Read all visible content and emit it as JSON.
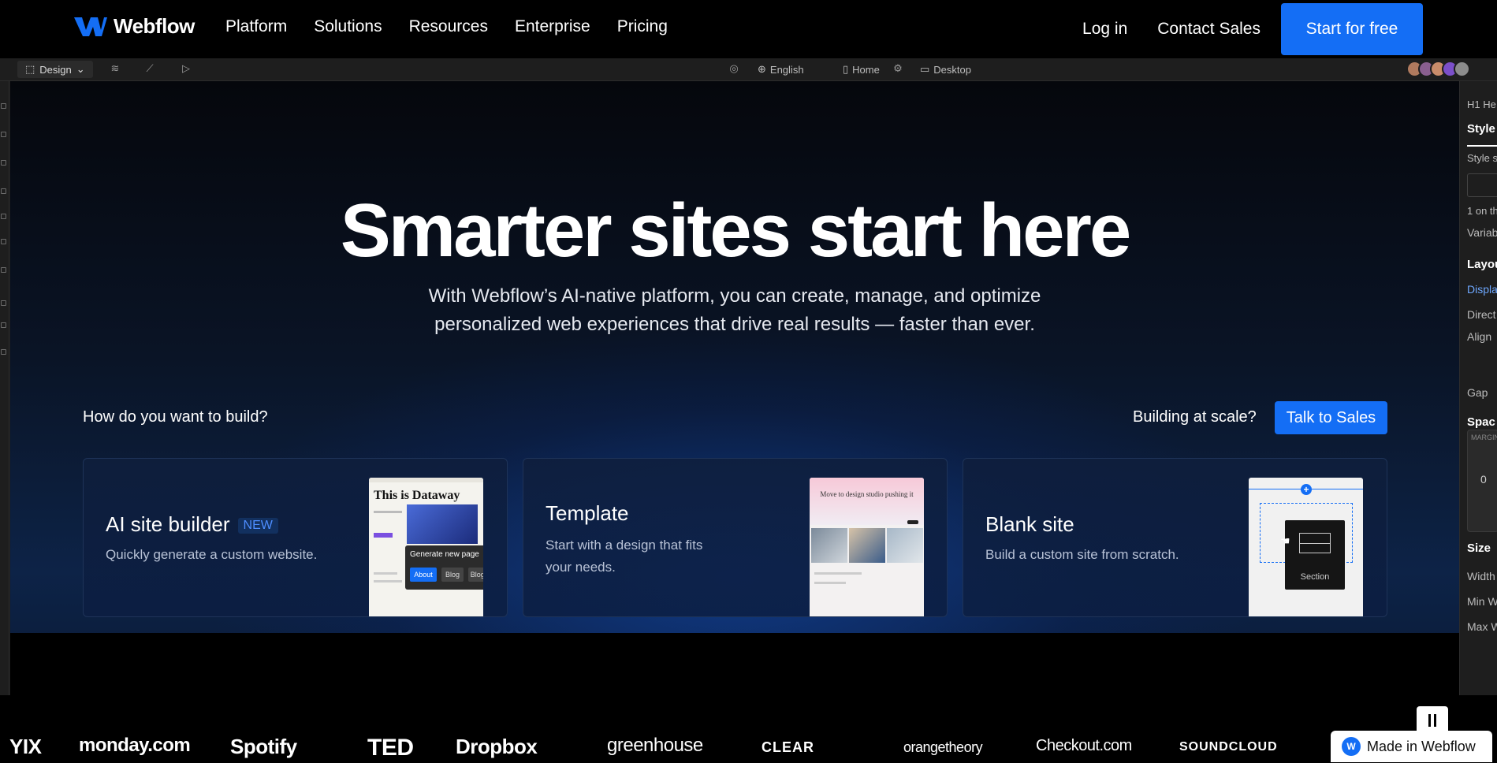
{
  "nav": {
    "brand": "Webflow",
    "links": [
      "Platform",
      "Solutions",
      "Resources",
      "Enterprise",
      "Pricing"
    ],
    "login": "Log in",
    "contact": "Contact Sales",
    "cta": "Start for free"
  },
  "designer_toolbar": {
    "mode": "Design",
    "locale": "English",
    "page": "Home",
    "breakpoint": "Desktop"
  },
  "right_panel": {
    "element": "H1 He",
    "tab": "Style",
    "style_selector": "Style s",
    "on_this": "1 on th",
    "variables": "Variab",
    "layout": "Layou",
    "display": "Displa",
    "direction": "Direct",
    "align": "Align",
    "gap": "Gap",
    "spacing": "Spac",
    "margin": "MARGIN",
    "margin_value": "0",
    "size": "Size",
    "width": "Width",
    "min_width": "Min W",
    "max_width": "Max W"
  },
  "hero": {
    "title": "Smarter sites start here",
    "subtitle_line1": "With Webflow’s AI-native platform, you can create, manage, and optimize",
    "subtitle_line2": "personalized web experiences that drive real results — faster than ever."
  },
  "build": {
    "question": "How do you want to build?",
    "scale_question": "Building at scale?",
    "talk_button": "Talk to Sales"
  },
  "cards": [
    {
      "title": "AI site builder",
      "badge": "NEW",
      "desc_line1": "Quickly generate a custom website.",
      "desc_line2": ""
    },
    {
      "title": "Template",
      "badge": "",
      "desc_line1": "Start with a design that fits",
      "desc_line2": "your needs."
    },
    {
      "title": "Blank site",
      "badge": "",
      "desc_line1": "Build a custom site from scratch.",
      "desc_line2": ""
    }
  ],
  "thumbs": {
    "ai": {
      "headline": "This is Dataway",
      "popup_title": "Generate new page",
      "pills": [
        "About",
        "Blog",
        "Blog Post"
      ]
    },
    "template": {
      "headline": "Move to design studio pushing it"
    },
    "blank": {
      "section_label": "Section"
    }
  },
  "logos": [
    "YIX",
    "monday.com",
    "Spotify",
    "TED",
    "Dropbox",
    "greenhouse",
    "CLEAR",
    "orangetheory",
    "Checkout.com",
    "SOUNDCLOUD"
  ],
  "made_in": "Made in Webflow",
  "colors": {
    "accent": "#146ef5",
    "bg": "#000000",
    "badge": "#4d8dff"
  }
}
